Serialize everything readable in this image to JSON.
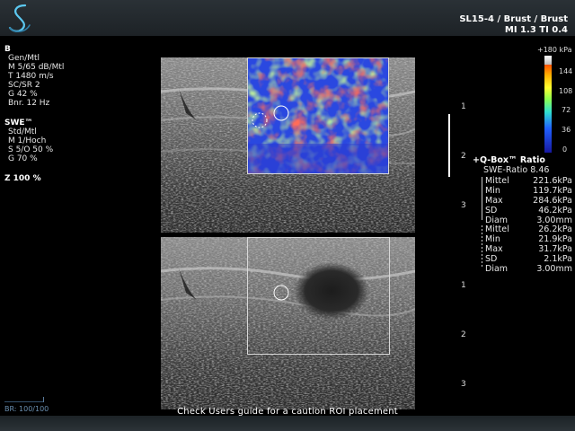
{
  "header": {
    "probe_preset": "SL15-4 / Brust / Brust",
    "indices": "MI 1.3  TI 0.4",
    "logo_icon": "supersonic-s-icon"
  },
  "params": {
    "b_mode": {
      "title": "B",
      "lines": [
        "Gen/Mtl",
        "M 5/65 dB/Mtl",
        "T 1480 m/s",
        "SC/SR 2",
        "G 42 %",
        "Bnr. 12 Hz"
      ]
    },
    "swe": {
      "title": "SWE™",
      "lines": [
        "Std/Mtl",
        "M 1/Hoch",
        "S 5/O 50 %",
        "G 70 %"
      ]
    },
    "zoom": "Z 100  %"
  },
  "depth_top": [
    "1",
    "2",
    "3"
  ],
  "depth_bottom": [
    "1",
    "2",
    "3"
  ],
  "colorbar": {
    "max_label": "+180 kPa",
    "ticks": [
      "144",
      "108",
      "72",
      "36",
      "0"
    ]
  },
  "qbox": {
    "title": "Q-Box™ Ratio",
    "ratio": "SWE-Ratio 8.46",
    "roi1": [
      {
        "k": "Mittel",
        "v": "221.6kPa"
      },
      {
        "k": "Min",
        "v": "119.7kPa"
      },
      {
        "k": "Max",
        "v": "284.6kPa"
      },
      {
        "k": "SD",
        "v": "46.2kPa"
      },
      {
        "k": "Diam",
        "v": "3.00mm"
      }
    ],
    "roi2": [
      {
        "k": "Mittel",
        "v": "26.2kPa"
      },
      {
        "k": "Min",
        "v": "21.9kPa"
      },
      {
        "k": "Max",
        "v": "31.7kPa"
      },
      {
        "k": "SD",
        "v": "2.1kPa"
      },
      {
        "k": "Diam",
        "v": "3.00mm"
      }
    ]
  },
  "footer": {
    "caution": "Check Users guide for a caution ROI placement",
    "br": "BR: 100/100"
  },
  "colors": {
    "background": "#000000",
    "header": "#242a2e",
    "logo": "#5cc8f0",
    "elastography_high": "#ff2020",
    "elastography_low": "#1a2ad0"
  }
}
